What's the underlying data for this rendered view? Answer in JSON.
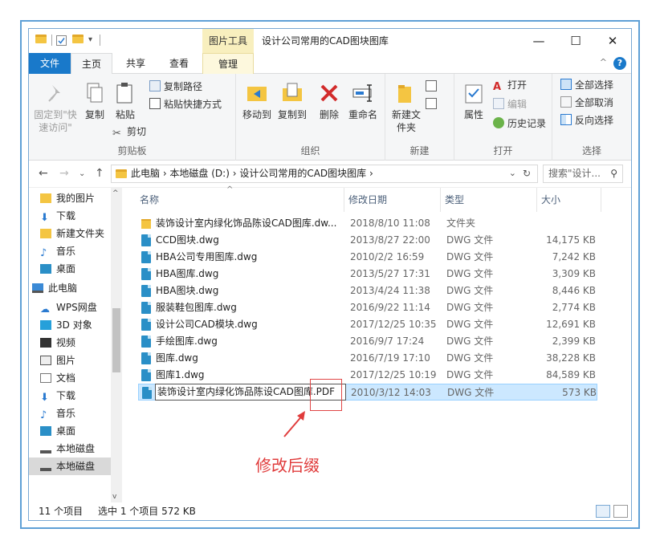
{
  "titlebar": {
    "context_tab": "图片工具",
    "title": "设计公司常用的CAD图块图库",
    "minimize": "—",
    "maximize": "☐",
    "close": "✕"
  },
  "tabs": [
    {
      "label": "文件"
    },
    {
      "label": "主页"
    },
    {
      "label": "共享"
    },
    {
      "label": "查看"
    },
    {
      "label": "管理"
    }
  ],
  "help": "?",
  "ribbon": {
    "clipboard": {
      "group_label": "剪贴板",
      "pin_label": "固定到\"快速访问\"",
      "copy_label": "复制",
      "paste_label": "粘贴",
      "copy_path": "复制路径",
      "paste_shortcut": "粘贴快捷方式",
      "cut": "剪切"
    },
    "organize": {
      "group_label": "组织",
      "move_to": "移动到",
      "copy_to": "复制到",
      "delete": "删除",
      "rename": "重命名"
    },
    "new": {
      "group_label": "新建",
      "new_folder": "新建文件夹"
    },
    "open": {
      "group_label": "打开",
      "properties": "属性",
      "open": "打开",
      "edit": "编辑",
      "history": "历史记录"
    },
    "select": {
      "group_label": "选择",
      "select_all": "全部选择",
      "select_none": "全部取消",
      "invert": "反向选择"
    }
  },
  "address": {
    "crumbs": "此电脑 › 本地磁盘 (D:) › 设计公司常用的CAD图块图库 ›",
    "search_placeholder": "搜索\"设计..."
  },
  "nav": [
    {
      "label": "我的图片",
      "icon": "folder-icon"
    },
    {
      "label": "下载",
      "icon": "download-icon"
    },
    {
      "label": "新建文件夹",
      "icon": "folder-icon"
    },
    {
      "label": "音乐",
      "icon": "music-icon"
    },
    {
      "label": "桌面",
      "icon": "desktop-icon"
    },
    {
      "label": "此电脑",
      "icon": "computer-icon"
    },
    {
      "label": "WPS网盘",
      "icon": "cloud-icon"
    },
    {
      "label": "3D 对象",
      "icon": "cube-icon"
    },
    {
      "label": "视频",
      "icon": "video-icon"
    },
    {
      "label": "图片",
      "icon": "picture-icon"
    },
    {
      "label": "文档",
      "icon": "document-icon"
    },
    {
      "label": "下载",
      "icon": "download-icon"
    },
    {
      "label": "音乐",
      "icon": "music-icon"
    },
    {
      "label": "桌面",
      "icon": "desktop-icon"
    },
    {
      "label": "本地磁盘",
      "icon": "drive-icon"
    },
    {
      "label": "本地磁盘",
      "icon": "drive-icon"
    }
  ],
  "columns": {
    "name": "名称",
    "date": "修改日期",
    "type": "类型",
    "size": "大小"
  },
  "files": [
    {
      "name": "装饰设计室内绿化饰品陈设CAD图库.dw...",
      "date": "2018/8/10 11:08",
      "type": "文件夹",
      "size": "",
      "icon": "folder-icon"
    },
    {
      "name": "CCD图块.dwg",
      "date": "2013/8/27 22:00",
      "type": "DWG 文件",
      "size": "14,175 KB",
      "icon": "dwg-file-icon"
    },
    {
      "name": "HBA公司专用图库.dwg",
      "date": "2010/2/2 16:59",
      "type": "DWG 文件",
      "size": "7,242 KB",
      "icon": "dwg-file-icon"
    },
    {
      "name": "HBA图库.dwg",
      "date": "2013/5/27 17:31",
      "type": "DWG 文件",
      "size": "3,309 KB",
      "icon": "dwg-file-icon"
    },
    {
      "name": "HBA图块.dwg",
      "date": "2013/4/24 11:38",
      "type": "DWG 文件",
      "size": "8,446 KB",
      "icon": "dwg-file-icon"
    },
    {
      "name": "服装鞋包图库.dwg",
      "date": "2016/9/22 11:14",
      "type": "DWG 文件",
      "size": "2,774 KB",
      "icon": "dwg-file-icon"
    },
    {
      "name": "设计公司CAD模块.dwg",
      "date": "2017/12/25 10:35",
      "type": "DWG 文件",
      "size": "12,691 KB",
      "icon": "dwg-file-icon"
    },
    {
      "name": "手绘图库.dwg",
      "date": "2016/9/7 17:24",
      "type": "DWG 文件",
      "size": "2,399 KB",
      "icon": "dwg-file-icon"
    },
    {
      "name": "图库.dwg",
      "date": "2016/7/19 17:10",
      "type": "DWG 文件",
      "size": "38,228 KB",
      "icon": "dwg-file-icon"
    },
    {
      "name": "图库1.dwg",
      "date": "2017/12/25 10:19",
      "type": "DWG 文件",
      "size": "84,589 KB",
      "icon": "dwg-file-icon"
    }
  ],
  "selected_file": {
    "rename_value": "装饰设计室内绿化饰品陈设CAD图库.PDF",
    "date": "2010/3/12 14:03",
    "type": "DWG 文件",
    "size": "573 KB"
  },
  "annotation": "修改后缀",
  "status": {
    "count": "11 个项目",
    "selection": "选中 1 个项目  572 KB"
  },
  "colors": {
    "accent": "#1979ca",
    "selection": "#cce8ff",
    "annotation": "#e03c3c"
  }
}
